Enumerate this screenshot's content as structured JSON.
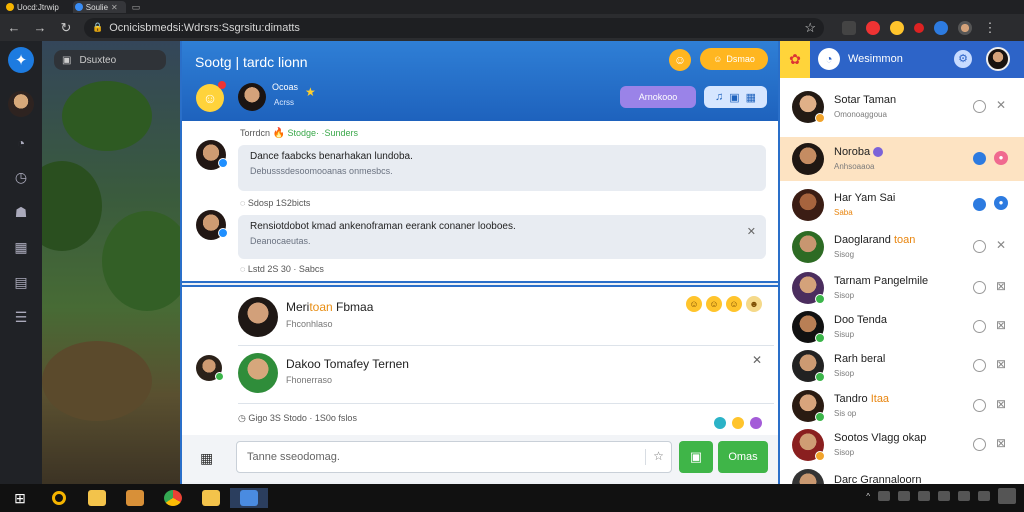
{
  "browser": {
    "tabs": [
      {
        "label": "Uocd:Jtrwip"
      },
      {
        "label": "Soulie"
      }
    ],
    "url": "Ocnicisbmedsi:Wdrsrs:Ssgrsitu:dimatts"
  },
  "sidebar": {
    "search_label": "Dsuxteo"
  },
  "chat": {
    "title": "Sootg | tardc lionn",
    "header_user": "Ocoas",
    "header_sub": "Acrss",
    "hdr_pill_label": "Dsmao",
    "hdr_purple_btn": "Arnokooo",
    "thread": {
      "meta_top": "Torrdcn",
      "meta_top_green": "Stodge· ·Sunders",
      "message1_line1": "Dance faabcks benarhakan lundoba.",
      "message1_line2": "Debusssdesoomooanas onmesbcs.",
      "meta_mid": "Sdosp 1S2bicts",
      "message2_line1": "Rensiotdobot kmad ankenoframan eerank conaner looboes.",
      "message2_line2": "Deanocaeutas.",
      "meta_bottom": "Lstd 2S 30 · Sabcs"
    },
    "cards": [
      {
        "name_pre": "Meri",
        "name_hl": "toan",
        "name_post": "Fbmaa",
        "sub": "Fhconhlaso"
      },
      {
        "name": "Dakoo Tomafey Ternen",
        "sub": "Fhonerraso"
      }
    ],
    "card_footer": "Gigo 3S Stodo · 1S0o fslos",
    "input_placeholder": "Tanne sseodomag.",
    "send_label": "Omas"
  },
  "contacts": {
    "title": "Wesimmon",
    "items": [
      {
        "name": "Sotar Taman",
        "sub": "Omonoaggoua"
      },
      {
        "name": "Noroba",
        "sub": "Anhsoaaoa"
      },
      {
        "name": "Har Yam Sai",
        "sub": "Saba"
      },
      {
        "name": "Daoglarand",
        "name_hl": "toan",
        "sub": "Sisog"
      },
      {
        "name": "Tarnam Pangelmile",
        "sub": "Sisop"
      },
      {
        "name": "Doo Tenda",
        "sub": "Sisup"
      },
      {
        "name": "Rarh beral",
        "sub": "Sisop"
      },
      {
        "name": "Tandro",
        "name_hl": "Itaa",
        "sub": "Sis op"
      },
      {
        "name": "Sootos Vlagg okap",
        "sub": "Sisop"
      },
      {
        "name": "Darc Grannaloorn",
        "sub": ""
      }
    ]
  },
  "colors": {
    "accent_blue": "#2a6fc9",
    "send_green": "#3fb548",
    "highlight_orange": "#fde3c2"
  }
}
